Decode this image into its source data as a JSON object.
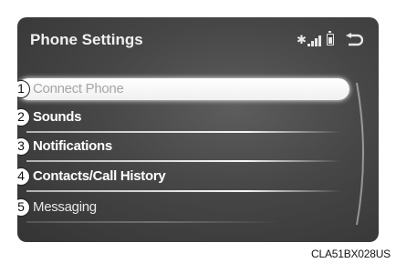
{
  "screen": {
    "title": "Phone Settings",
    "status_icons": [
      "bluetooth-icon",
      "signal-icon",
      "battery-icon"
    ],
    "back_icon": "back-icon",
    "accent_color": "#ffffff",
    "background_color": "#444444"
  },
  "menu": {
    "items": [
      {
        "number": "1",
        "label": "Connect Phone",
        "selected": true
      },
      {
        "number": "2",
        "label": "Sounds"
      },
      {
        "number": "3",
        "label": "Notifications"
      },
      {
        "number": "4",
        "label": "Contacts/Call History"
      },
      {
        "number": "5",
        "label": "Messaging"
      }
    ]
  },
  "figure_code": "CLA51BX028US"
}
